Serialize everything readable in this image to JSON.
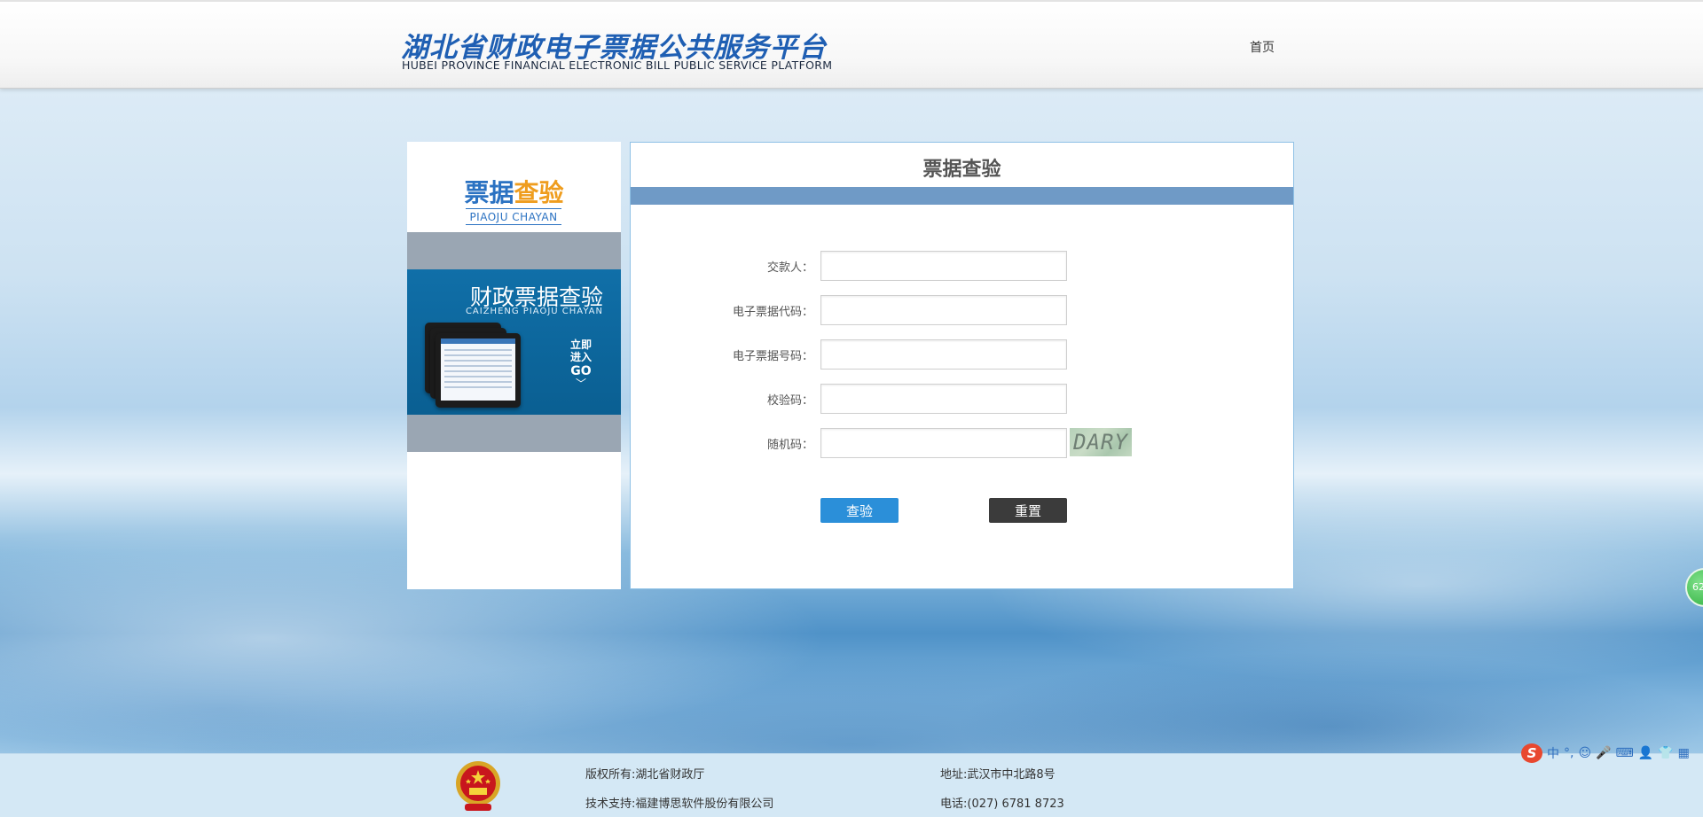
{
  "header": {
    "logo_cn": "湖北省财政电子票据公共服务平台",
    "logo_en": "HUBEI PROVINCE FINANCIAL ELECTRONIC BILL PUBLIC SERVICE PLATFORM",
    "nav_home": "首页"
  },
  "left_panel": {
    "title_part1": "票据",
    "title_part2": "查验",
    "pinyin": "PIAOJU CHAYAN",
    "promo_title": "财政票据查验",
    "promo_subtitle": "CAIZHENG PIAOJU CHAYAN",
    "promo_line1": "立即",
    "promo_line2": "进入",
    "promo_go": "GO",
    "promo_chevron": "﹀"
  },
  "form": {
    "heading": "票据查验",
    "fields": [
      {
        "label": "交款人：",
        "value": ""
      },
      {
        "label": "电子票据代码：",
        "value": ""
      },
      {
        "label": "电子票据号码：",
        "value": ""
      },
      {
        "label": "校验码：",
        "value": ""
      },
      {
        "label": "随机码：",
        "value": ""
      }
    ],
    "captcha_text": "DARY",
    "check_button": "查验",
    "reset_button": "重置"
  },
  "side_float": {
    "text": "62"
  },
  "footer": {
    "copyright": "版权所有:湖北省财政厅",
    "tech_support": "技术支持:福建博思软件股份有限公司",
    "address": "地址:武汉市中北路8号",
    "phone": "电话:(027) 6781 8723"
  },
  "ime": {
    "logo": "S",
    "mode": "中",
    "punct": "°,",
    "emoji": "☺",
    "mic": "🎤",
    "keyboard": "⌨",
    "user": "👤",
    "skin": "👕",
    "grid": "▦"
  },
  "colors": {
    "brand_blue": "#1f5fb3",
    "accent_orange": "#ef9d1e",
    "form_bar": "#6f9ac6",
    "check_button": "#2b8fd9",
    "reset_button": "#3b3b3b"
  }
}
